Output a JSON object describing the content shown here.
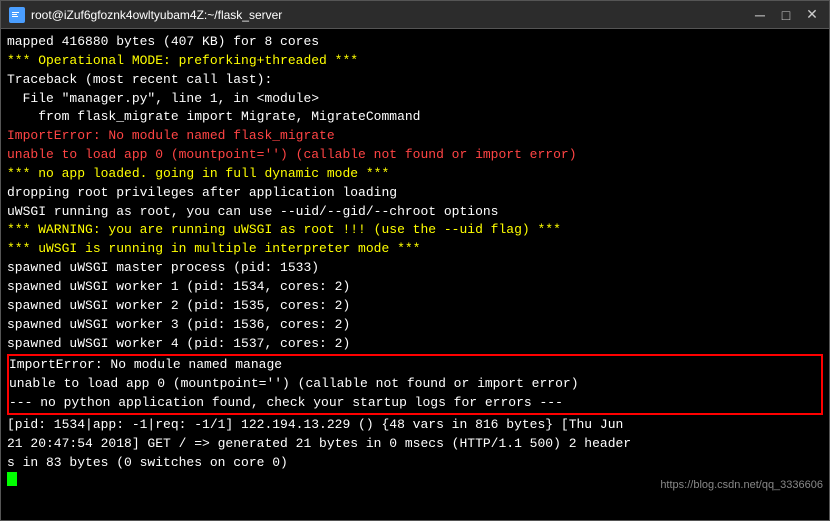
{
  "titleBar": {
    "icon": "T",
    "title": "root@iZuf6gfoznk4owltyubam4Z:~/flask_server",
    "minimizeLabel": "─",
    "maximizeLabel": "□",
    "closeLabel": "✕"
  },
  "terminal": {
    "lines": [
      {
        "text": "mapped 416880 bytes (407 KB) for 8 cores",
        "color": "white"
      },
      {
        "text": "*** Operational MODE: preforking+threaded ***",
        "color": "yellow"
      },
      {
        "text": "Traceback (most recent call last):",
        "color": "white"
      },
      {
        "text": "  File \"manager.py\", line 1, in <module>",
        "color": "white"
      },
      {
        "text": "    from flask_migrate import Migrate, MigrateCommand",
        "color": "white"
      },
      {
        "text": "ImportError: No module named flask_migrate",
        "color": "red"
      },
      {
        "text": "unable to load app 0 (mountpoint='') (callable not found or import error)",
        "color": "red"
      },
      {
        "text": "*** no app loaded. going in full dynamic mode ***",
        "color": "yellow"
      },
      {
        "text": "dropping root privileges after application loading",
        "color": "white"
      },
      {
        "text": "uWSGI running as root, you can use --uid/--gid/--chroot options",
        "color": "white"
      },
      {
        "text": "*** WARNING: you are running uWSGI as root !!! (use the --uid flag) ***",
        "color": "yellow"
      },
      {
        "text": "*** uWSGI is running in multiple interpreter mode ***",
        "color": "yellow"
      },
      {
        "text": "spawned uWSGI master process (pid: 1533)",
        "color": "white"
      },
      {
        "text": "spawned uWSGI worker 1 (pid: 1534, cores: 2)",
        "color": "white"
      },
      {
        "text": "spawned uWSGI worker 2 (pid: 1535, cores: 2)",
        "color": "white"
      },
      {
        "text": "spawned uWSGI worker 3 (pid: 1536, cores: 2)",
        "color": "white"
      },
      {
        "text": "spawned uWSGI worker 4 (pid: 1537, cores: 2)",
        "color": "white"
      }
    ],
    "highlightedLines": [
      {
        "text": "ImportError: No module named manage",
        "color": "white"
      },
      {
        "text": "unable to load app 0 (mountpoint='') (callable not found or import error)",
        "color": "white"
      },
      {
        "text": "--- no python application found, check your startup logs for errors ---",
        "color": "white"
      }
    ],
    "afterLines": [
      {
        "text": "[pid: 1534|app: -1|req: -1/1] 122.194.13.229 () {48 vars in 816 bytes} [Thu Jun",
        "color": "white"
      },
      {
        "text": "21 20:47:54 2018] GET / => generated 21 bytes in 0 msecs (HTTP/1.1 500) 2 header",
        "color": "white"
      },
      {
        "text": "s in 83 bytes (0 switches on core 0)",
        "color": "white"
      }
    ],
    "watermark": "https://blog.csdn.net/qq_3336606"
  }
}
